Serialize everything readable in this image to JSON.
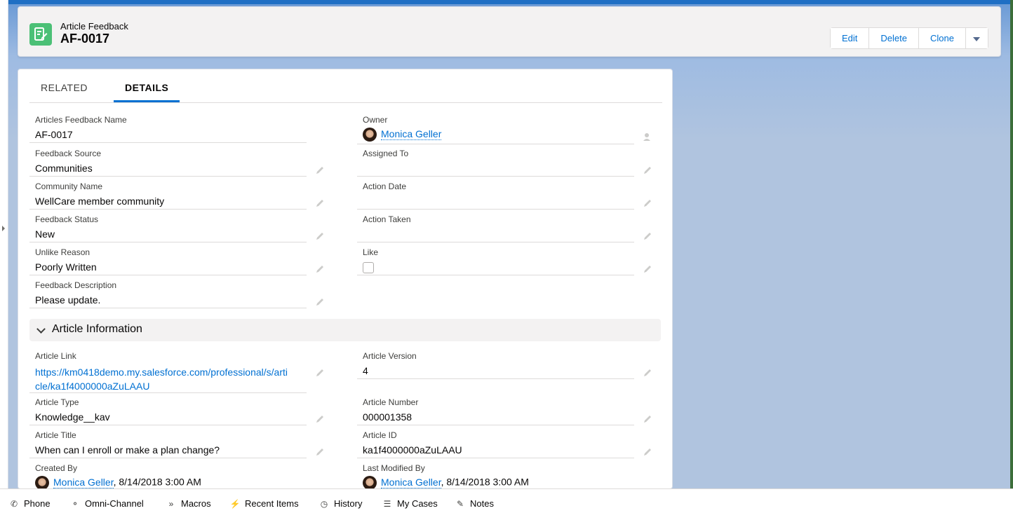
{
  "header": {
    "object_type": "Article Feedback",
    "record_name": "AF-0017",
    "actions": {
      "edit": "Edit",
      "delete": "Delete",
      "clone": "Clone"
    }
  },
  "tabs": {
    "related": "RELATED",
    "details": "DETAILS"
  },
  "details": {
    "articles_feedback_name": {
      "label": "Articles Feedback Name",
      "value": "AF-0017"
    },
    "owner": {
      "label": "Owner",
      "value": "Monica Geller"
    },
    "feedback_source": {
      "label": "Feedback Source",
      "value": "Communities"
    },
    "assigned_to": {
      "label": "Assigned To",
      "value": ""
    },
    "community_name": {
      "label": "Community Name",
      "value": "WellCare member community"
    },
    "action_date": {
      "label": "Action Date",
      "value": ""
    },
    "feedback_status": {
      "label": "Feedback Status",
      "value": "New"
    },
    "action_taken": {
      "label": "Action Taken",
      "value": ""
    },
    "unlike_reason": {
      "label": "Unlike Reason",
      "value": "Poorly Written"
    },
    "like": {
      "label": "Like",
      "checked": false
    },
    "feedback_description": {
      "label": "Feedback Description",
      "value": "Please update."
    }
  },
  "article_section": {
    "title": "Article Information",
    "article_link": {
      "label": "Article Link",
      "line1": "https://km0418demo.my.salesforce.com/professional/s/arti",
      "line2": "cle/ka1f4000000aZuLAAU"
    },
    "article_version": {
      "label": "Article Version",
      "value": "4"
    },
    "article_type": {
      "label": "Article Type",
      "value": "Knowledge__kav"
    },
    "article_number": {
      "label": "Article Number",
      "value": "000001358"
    },
    "article_title": {
      "label": "Article Title",
      "value": "When can I enroll or make a plan change?"
    },
    "article_id": {
      "label": "Article ID",
      "value": "ka1f4000000aZuLAAU"
    },
    "created_by": {
      "label": "Created By",
      "user": "Monica Geller",
      "date": ", 8/14/2018 3:00 AM"
    },
    "last_modified_by": {
      "label": "Last Modified By",
      "user": "Monica Geller",
      "date": ", 8/14/2018 3:00 AM"
    }
  },
  "utility_bar": [
    {
      "label": "Phone",
      "icon": "phone-icon"
    },
    {
      "label": "Omni-Channel",
      "icon": "omni-channel-icon"
    },
    {
      "label": "Macros",
      "icon": "macros-icon"
    },
    {
      "label": "Recent Items",
      "icon": "lightning-icon"
    },
    {
      "label": "History",
      "icon": "clock-icon"
    },
    {
      "label": "My Cases",
      "icon": "list-icon"
    },
    {
      "label": "Notes",
      "icon": "notes-icon"
    }
  ]
}
